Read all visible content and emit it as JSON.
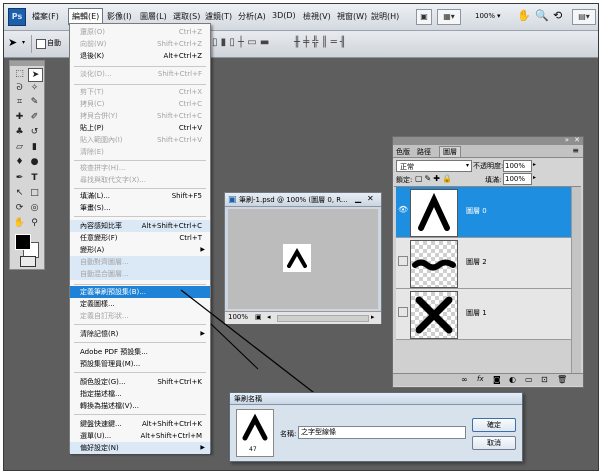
{
  "app": {
    "logo": "Ps"
  },
  "menubar": {
    "items": [
      "檔案(F)",
      "編輯(E)",
      "影像(I)",
      "圖層(L)",
      "選取(S)",
      "濾鏡(T)",
      "分析(A)",
      "3D(D)",
      "檢視(V)",
      "視窗(W)",
      "說明(H)"
    ],
    "zoom": "100%",
    "zoom_arrow": "▾"
  },
  "optionsbar": {
    "tool_icon": "move-tool",
    "checkbox_label": "自動"
  },
  "edit_menu": {
    "items": [
      {
        "label": "還原(O)",
        "shortcut": "Ctrl+Z",
        "state": "disabled"
      },
      {
        "label": "向前(W)",
        "shortcut": "Shift+Ctrl+Z",
        "state": "disabled"
      },
      {
        "label": "退後(K)",
        "shortcut": "Alt+Ctrl+Z",
        "state": "normal"
      },
      {
        "label": "淡化(D)...",
        "shortcut": "Shift+Ctrl+F",
        "state": "disabled"
      },
      {
        "label": "剪下(T)",
        "shortcut": "Ctrl+X",
        "state": "disabled"
      },
      {
        "label": "拷貝(C)",
        "shortcut": "Ctrl+C",
        "state": "disabled"
      },
      {
        "label": "拷貝合併(Y)",
        "shortcut": "Shift+Ctrl+C",
        "state": "disabled"
      },
      {
        "label": "貼上(P)",
        "shortcut": "Ctrl+V",
        "state": "normal"
      },
      {
        "label": "貼入範圍內(I)",
        "shortcut": "Shift+Ctrl+V",
        "state": "disabled"
      },
      {
        "label": "清除(E)",
        "shortcut": "",
        "state": "disabled"
      },
      {
        "label": "檢查拼字(H)...",
        "shortcut": "",
        "state": "disabled"
      },
      {
        "label": "尋找與取代文字(X)...",
        "shortcut": "",
        "state": "disabled"
      },
      {
        "label": "填滿(L)...",
        "shortcut": "Shift+F5",
        "state": "normal"
      },
      {
        "label": "筆畫(S)...",
        "shortcut": "",
        "state": "normal"
      },
      {
        "label": "內容感知比率",
        "shortcut": "Alt+Shift+Ctrl+C",
        "state": "highlight"
      },
      {
        "label": "任意變形(F)",
        "shortcut": "Ctrl+T",
        "state": "normal"
      },
      {
        "label": "變形(A)",
        "shortcut": "",
        "state": "submenu"
      },
      {
        "label": "自動對齊圖層...",
        "shortcut": "",
        "state": "disabled-hl"
      },
      {
        "label": "自動混合圖層...",
        "shortcut": "",
        "state": "disabled-hl"
      },
      {
        "label": "定義筆刷預設集(B)...",
        "shortcut": "",
        "state": "selected"
      },
      {
        "label": "定義圖樣...",
        "shortcut": "",
        "state": "normal"
      },
      {
        "label": "定義自訂形狀...",
        "shortcut": "",
        "state": "disabled"
      },
      {
        "label": "清除記憶(R)",
        "shortcut": "",
        "state": "submenu"
      },
      {
        "label": "Adobe PDF 預設集...",
        "shortcut": "",
        "state": "normal"
      },
      {
        "label": "預設集管理員(M)...",
        "shortcut": "",
        "state": "normal"
      },
      {
        "label": "顏色設定(G)...",
        "shortcut": "Shift+Ctrl+K",
        "state": "normal"
      },
      {
        "label": "指定描述檔...",
        "shortcut": "",
        "state": "normal"
      },
      {
        "label": "轉換為描述檔(V)...",
        "shortcut": "",
        "state": "normal"
      },
      {
        "label": "鍵盤快速鍵...",
        "shortcut": "Alt+Shift+Ctrl+K",
        "state": "normal"
      },
      {
        "label": "選單(U)...",
        "shortcut": "Alt+Shift+Ctrl+M",
        "state": "normal"
      },
      {
        "label": "偏好設定(N)",
        "shortcut": "",
        "state": "submenu-hl"
      }
    ]
  },
  "document": {
    "title": "筆刷-1.psd @ 100% (圖層 0, R...",
    "zoom": "100%",
    "scroll_left": "◂",
    "scroll_right": "▸"
  },
  "layers_panel": {
    "tabs": [
      "圖層",
      "色版",
      "路徑"
    ],
    "blend_mode": "正常",
    "opacity_label": "不透明度:",
    "opacity_value": "100%",
    "lock_label": "鎖定:",
    "fill_label": "填滿:",
    "fill_value": "100%",
    "layers": [
      {
        "name": "圖層 0",
        "selected": true,
        "visible": true
      },
      {
        "name": "圖層 2",
        "selected": false,
        "visible": false
      },
      {
        "name": "圖層 1",
        "selected": false,
        "visible": false
      }
    ],
    "footer_icons": [
      "link-icon",
      "fx-icon",
      "mask-icon",
      "adjustment-icon",
      "group-icon",
      "new-layer-icon",
      "trash-icon"
    ]
  },
  "dialog": {
    "title": "筆刷名稱",
    "name_label": "名稱:",
    "name_value": "之字型線條",
    "brush_size": "47",
    "ok_label": "確定",
    "cancel_label": "取消"
  },
  "colors": {
    "accent": "#1e82d6",
    "selected_layer": "#1e8fe0",
    "workspace": "#5e5e5e"
  }
}
